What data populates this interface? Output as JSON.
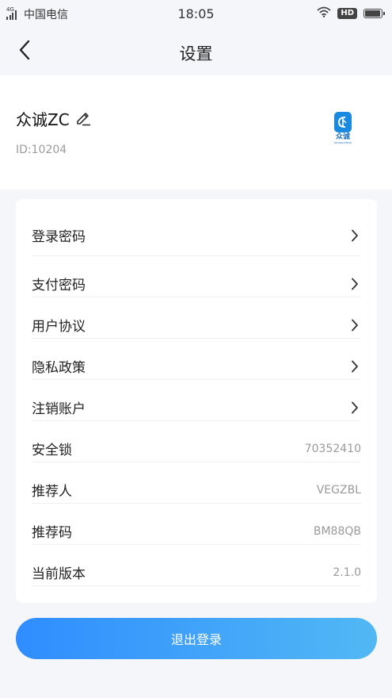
{
  "status_bar": {
    "network": "4G",
    "carrier": "中国电信",
    "time": "18:05",
    "hd_label": "HD",
    "battery_level": 0.95
  },
  "nav": {
    "title": "设置"
  },
  "profile": {
    "name": "众诚ZC",
    "id_text": "ID:10204",
    "logo_text": "众诚",
    "logo_subtext": "ZHONGCHENG"
  },
  "settings": {
    "items": [
      {
        "label": "登录密码",
        "value": ""
      },
      {
        "label": "支付密码",
        "value": ""
      },
      {
        "label": "用户协议",
        "value": ""
      },
      {
        "label": "隐私政策",
        "value": ""
      },
      {
        "label": "注销账户",
        "value": ""
      },
      {
        "label": "安全锁",
        "value": "70352410"
      },
      {
        "label": "推荐人",
        "value": "VEGZBL"
      },
      {
        "label": "推荐码",
        "value": "BM88QB"
      },
      {
        "label": "当前版本",
        "value": "2.1.0"
      }
    ]
  },
  "logout": {
    "label": "退出登录"
  },
  "colors": {
    "accent_start": "#2f8dff",
    "accent_end": "#52b8f4",
    "background": "#f4f6f9",
    "muted_text": "#9a9a9a"
  }
}
